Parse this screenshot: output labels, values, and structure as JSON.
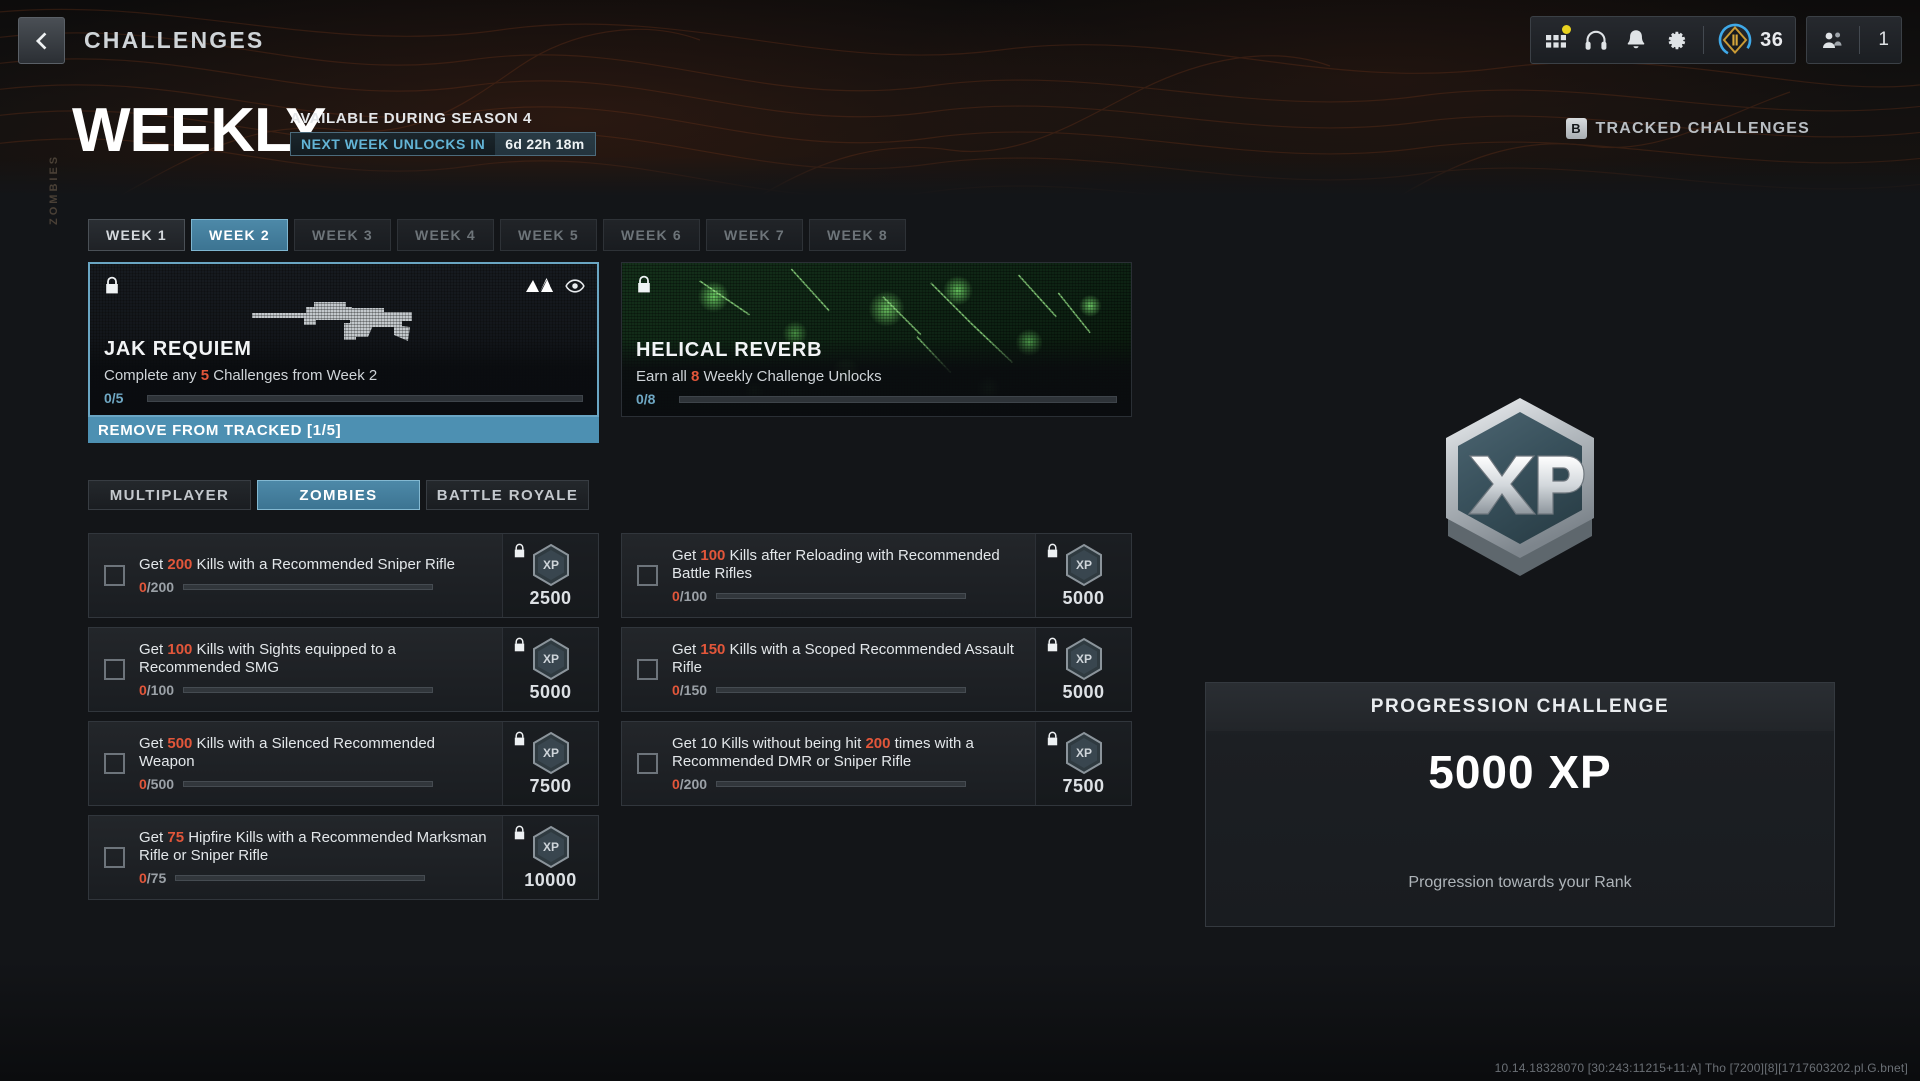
{
  "header": {
    "back_icon": "chevron-left-icon",
    "title": "CHALLENGES",
    "icons": [
      {
        "name": "apps-grid-icon",
        "has_badge": true
      },
      {
        "name": "headphones-icon",
        "has_badge": false
      },
      {
        "name": "bell-icon",
        "has_badge": false
      },
      {
        "name": "gear-icon",
        "has_badge": false
      }
    ],
    "rank_value": "36",
    "party_count": "1"
  },
  "hero": {
    "vertical_label": "ZOMBIES",
    "title": "WEEKLY",
    "subtitle": "AVAILABLE DURING SEASON 4",
    "timer_label": "NEXT WEEK UNLOCKS IN",
    "timer_value": "6d 22h 18m",
    "tracked_key": "B",
    "tracked_label": "TRACKED CHALLENGES"
  },
  "week_tabs": [
    {
      "label": "WEEK 1",
      "state": "unlocked"
    },
    {
      "label": "WEEK 2",
      "state": "active"
    },
    {
      "label": "WEEK 3",
      "state": "locked"
    },
    {
      "label": "WEEK 4",
      "state": "locked"
    },
    {
      "label": "WEEK 5",
      "state": "locked"
    },
    {
      "label": "WEEK 6",
      "state": "locked"
    },
    {
      "label": "WEEK 7",
      "state": "locked"
    },
    {
      "label": "WEEK 8",
      "state": "locked"
    }
  ],
  "rewards": [
    {
      "name": "JAK REQUIEM",
      "description_pre": "Complete any ",
      "description_hl": "5",
      "description_post": " Challenges from Week 2",
      "progress_text": "0/5",
      "progress_pct": 0,
      "lock_icon": "lock-icon",
      "badge_icon": "blueprint-icon",
      "eye_icon": "eye-icon",
      "track_button": "REMOVE FROM TRACKED [1/5]",
      "art": "weapon-silhouette"
    },
    {
      "name": "HELICAL REVERB",
      "description_pre": "Earn all ",
      "description_hl": "8",
      "description_post": " Weekly Challenge Unlocks",
      "progress_text": "0/8",
      "progress_pct": 0,
      "lock_icon": "lock-icon",
      "track_button": "",
      "art": "green-abstract"
    }
  ],
  "mode_tabs": [
    {
      "label": "MULTIPLAYER",
      "state": "inactive"
    },
    {
      "label": "ZOMBIES",
      "state": "active"
    },
    {
      "label": "BATTLE ROYALE",
      "state": "inactive"
    }
  ],
  "challenges_left": [
    {
      "desc_pre": "Get ",
      "desc_hl": "200",
      "desc_post": " Kills with a Recommended Sniper Rifle",
      "current": "0",
      "total": "/200",
      "progress_pct": 0,
      "xp": "2500",
      "locked": true
    },
    {
      "desc_pre": "Get ",
      "desc_hl": "100",
      "desc_post": " Kills with Sights equipped to a Recommended SMG",
      "current": "0",
      "total": "/100",
      "progress_pct": 0,
      "xp": "5000",
      "locked": true
    },
    {
      "desc_pre": "Get ",
      "desc_hl": "500",
      "desc_post": " Kills with a Silenced Recommended Weapon",
      "current": "0",
      "total": "/500",
      "progress_pct": 0,
      "xp": "7500",
      "locked": true
    },
    {
      "desc_pre": "Get ",
      "desc_hl": "75",
      "desc_post": " Hipfire Kills with a Recommended Marksman Rifle or Sniper Rifle",
      "current": "0",
      "total": "/75",
      "progress_pct": 0,
      "xp": "10000",
      "locked": true
    }
  ],
  "challenges_right": [
    {
      "desc_pre": "Get ",
      "desc_hl": "100",
      "desc_post": " Kills after Reloading with Recommended Battle Rifles",
      "current": "0",
      "total": "/100",
      "progress_pct": 0,
      "xp": "5000",
      "locked": true
    },
    {
      "desc_pre": "Get ",
      "desc_hl": "150",
      "desc_post": " Kills with a Scoped Recommended Assault Rifle",
      "current": "0",
      "total": "/150",
      "progress_pct": 0,
      "xp": "5000",
      "locked": true
    },
    {
      "desc_pre": "Get 10 Kills without being hit ",
      "desc_hl": "200",
      "desc_post": " times with a Recommended DMR or Sniper Rifle",
      "current": "0",
      "total": "/200",
      "progress_pct": 0,
      "xp": "7500",
      "locked": true
    }
  ],
  "right_panel": {
    "xp_badge_label": "XP",
    "card_title": "PROGRESSION CHALLENGE",
    "card_amount": "5000 XP",
    "card_note": "Progression towards your Rank"
  },
  "footer": {
    "build_string": "10.14.18328070 [30:243:11215+11:A] Tho [7200][8][1717603202.pl.G.bnet]"
  },
  "colors": {
    "accent_blue": "#4d90b2",
    "highlight_red": "#e2563a",
    "progress_blue": "#6fa8c4",
    "badge_yellow": "#e8d21f"
  }
}
